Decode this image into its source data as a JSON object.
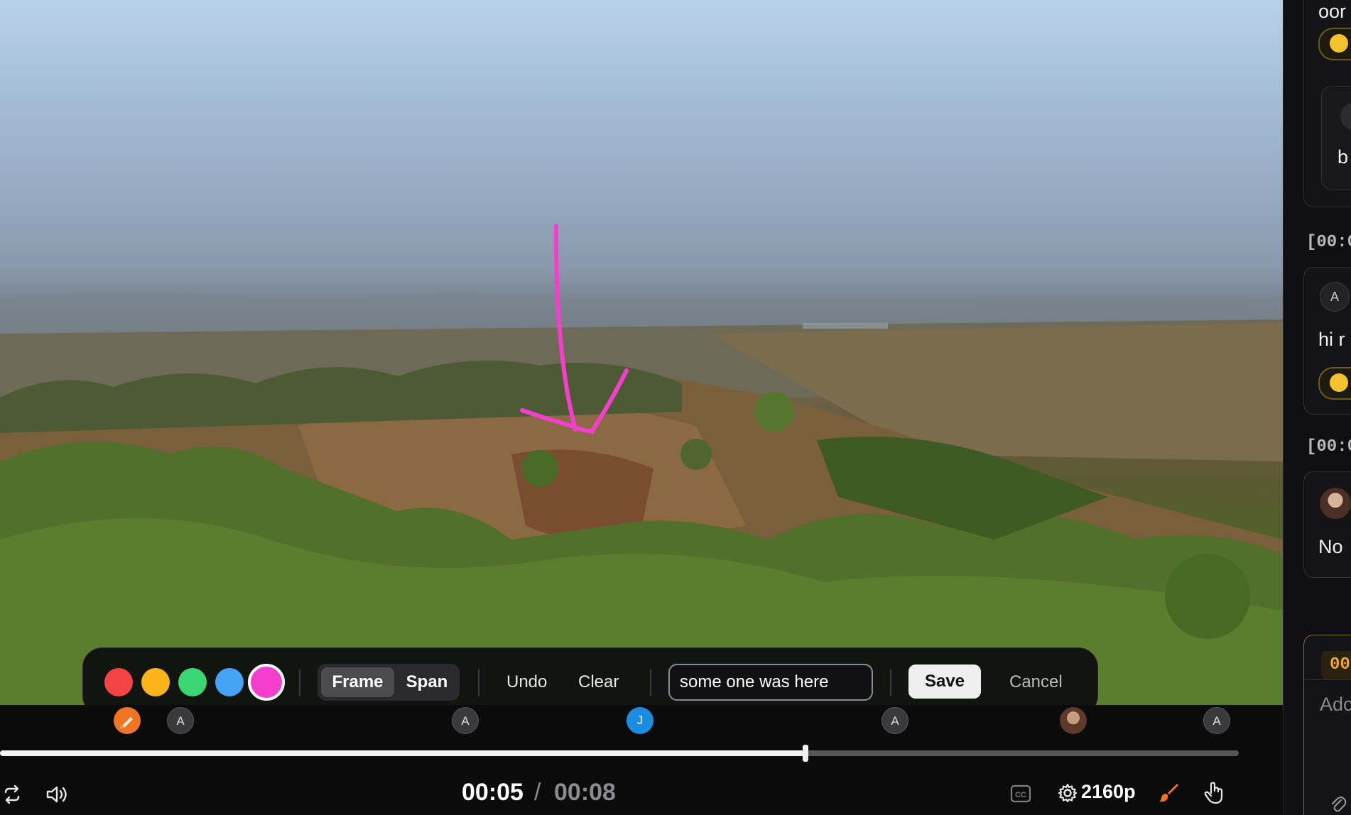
{
  "toolbar": {
    "colors": [
      {
        "name": "red",
        "hex": "#f24444",
        "selected": false
      },
      {
        "name": "yellow",
        "hex": "#fbb519",
        "selected": false
      },
      {
        "name": "green",
        "hex": "#3ad673",
        "selected": false
      },
      {
        "name": "blue",
        "hex": "#46a4f7",
        "selected": false
      },
      {
        "name": "pink",
        "hex": "#f33fcb",
        "selected": true
      }
    ],
    "mode_frame": "Frame",
    "mode_span": "Span",
    "active_mode": "Frame",
    "undo": "Undo",
    "clear": "Clear",
    "note_value": "some one was here",
    "save": "Save",
    "cancel": "Cancel"
  },
  "drawing": {
    "color": "#f33fcb",
    "shape": "arrow"
  },
  "markers": [
    {
      "label": "",
      "type": "pen-icon",
      "color": "#f07522"
    },
    {
      "label": "A",
      "type": "avatar"
    },
    {
      "label": "A",
      "type": "avatar"
    },
    {
      "label": "J",
      "type": "avatar",
      "color": "#1b8de0"
    },
    {
      "label": "A",
      "type": "avatar"
    },
    {
      "label": "",
      "type": "photo-avatar"
    },
    {
      "label": "A",
      "type": "avatar"
    }
  ],
  "player": {
    "current_time": "00:05",
    "separator": "/",
    "duration": "00:08",
    "progress_fraction": 0.65,
    "quality": "2160p",
    "cc_label": "CC"
  },
  "comments_panel": {
    "top_partial": "oor",
    "reply_partial": "b",
    "ts1": "[00:0",
    "comment_avatar": "A",
    "comment_text": "hi r",
    "ts2": "[00:0",
    "comment3_text": "No",
    "draft_time": "00",
    "add_placeholder": "Adc"
  }
}
